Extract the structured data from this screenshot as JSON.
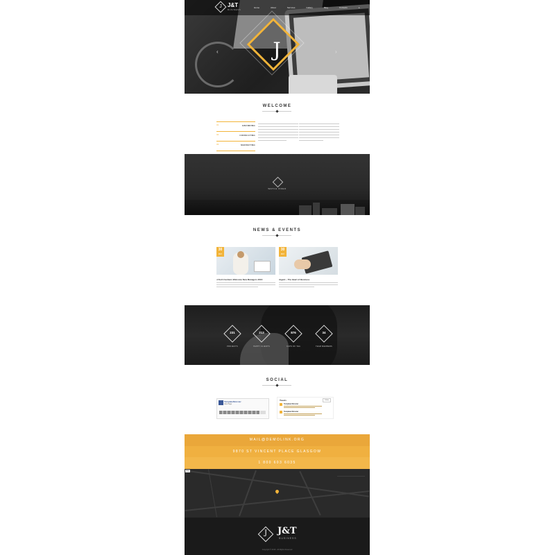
{
  "header": {
    "logo_mark": "J",
    "logo_text": "J&T",
    "logo_sub": "BUSINESS",
    "menu": [
      "Home",
      "About",
      "Services",
      "Gallery",
      "Blog",
      "Contacts"
    ],
    "hero_letter": "J",
    "prev_arrow": "‹",
    "next_arrow": "›"
  },
  "welcome": {
    "title": "WELCOME",
    "tabs": [
      {
        "num": "01",
        "label": "BRANDING"
      },
      {
        "num": "02",
        "label": "CONSULTING"
      },
      {
        "num": "03",
        "label": "MARKETING"
      }
    ]
  },
  "video": {
    "label": "WATCH VIDEO"
  },
  "news": {
    "title": "NEWS & EVENTS",
    "items": [
      {
        "day": "30",
        "month": "MAY",
        "title": "J-Tech Cashiers Welcome New Managers 2016"
      },
      {
        "day": "30",
        "month": "MAY",
        "title": "iAgent – The Heart of Business"
      }
    ]
  },
  "stats": [
    {
      "value": "231",
      "label": "PROJECTS"
    },
    {
      "value": "213",
      "label": "HAPPY CLIENTS"
    },
    {
      "value": "876",
      "label": "CUPS OF TEA"
    },
    {
      "value": "34",
      "label": "TEAM MEMBERS"
    }
  ],
  "social": {
    "title": "SOCIAL",
    "facebook": {
      "name": "TemplateMonster",
      "likes": "Like Page"
    },
    "twitter": {
      "heading": "Tweets",
      "follow": "Follow",
      "user": "Template Monster"
    }
  },
  "contacts": {
    "email": "MAIL@DEMOLINK.ORG",
    "address": "9870 ST VINCENT PLACE GLASGOW",
    "phone": "1 800 603 6035"
  },
  "map": {
    "control": "Map"
  },
  "footer": {
    "logo_letter": "J",
    "brand": "J&T",
    "sub": "BUSINESS",
    "copyright": "Copyright © 2016 · All Rights Reserved"
  },
  "colors": {
    "accent": "#f2b43a",
    "dark": "#1a1a1a"
  }
}
